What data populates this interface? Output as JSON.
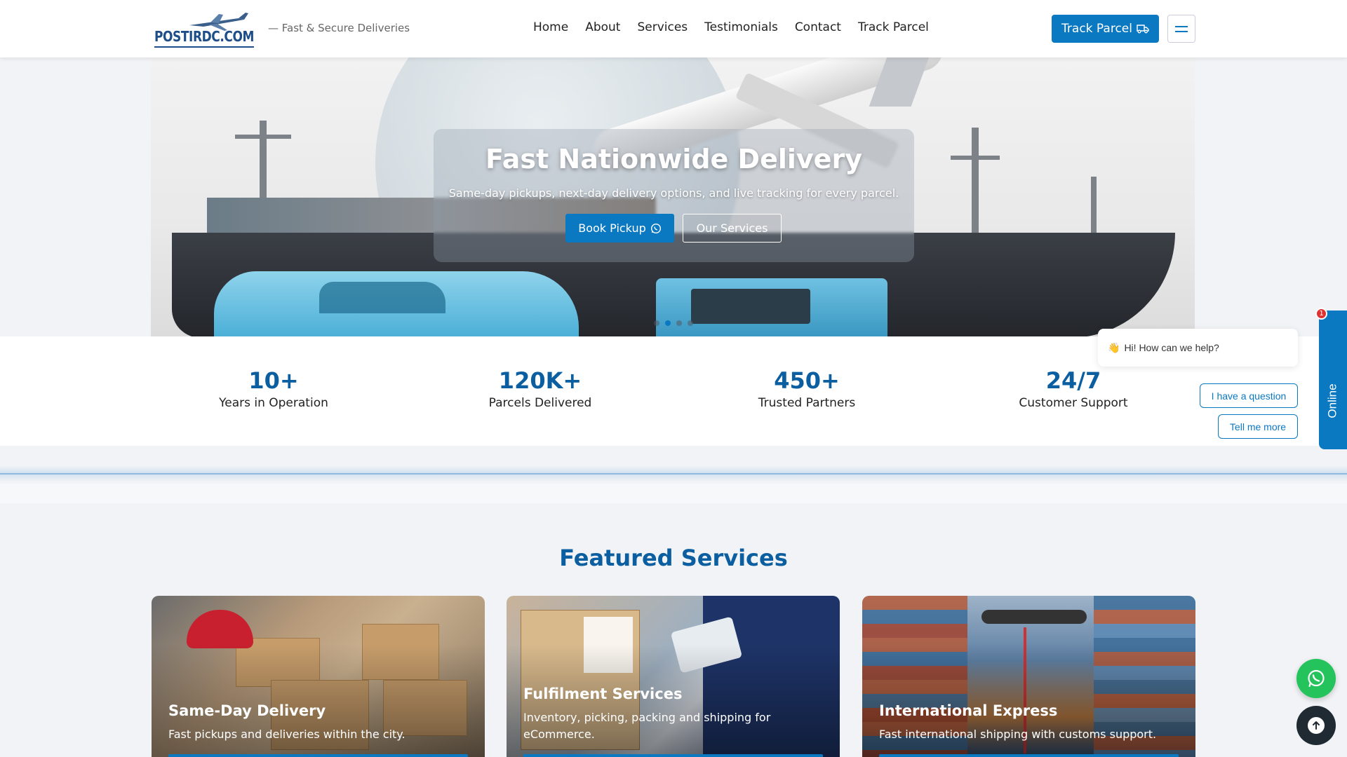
{
  "header": {
    "logo_text": "POSTIRDC.COM",
    "tagline": "— Fast & Secure Deliveries",
    "nav": [
      "Home",
      "About",
      "Services",
      "Testimonials",
      "Contact",
      "Track Parcel"
    ],
    "cta_label": "Track Parcel"
  },
  "hero": {
    "title": "Fast Nationwide Delivery",
    "subtitle": "Same-day pickups, next-day delivery options, and live tracking for every parcel.",
    "primary_button": "Book Pickup",
    "secondary_button": "Our Services",
    "slides": 4,
    "active_slide": 1
  },
  "stats": [
    {
      "value": "10+",
      "label": "Years in Operation"
    },
    {
      "value": "120K+",
      "label": "Parcels Delivered"
    },
    {
      "value": "450+",
      "label": "Trusted Partners"
    },
    {
      "value": "24/7",
      "label": "Customer Support"
    }
  ],
  "featured": {
    "title": "Featured Services",
    "cards": [
      {
        "title": "Same-Day Delivery",
        "desc": "Fast pickups and deliveries within the city."
      },
      {
        "title": "Fulfilment Services",
        "desc": "Inventory, picking, packing and shipping for eCommerce."
      },
      {
        "title": "International Express",
        "desc": "Fast international shipping with customs support."
      }
    ]
  },
  "chat": {
    "greeting": "Hi! How can we help?",
    "emoji": "👋",
    "option1": "I have a question",
    "option2": "Tell me more",
    "status": "Online",
    "badge": "1"
  },
  "colors": {
    "primary": "#0b78c2",
    "heading": "#0b5fa0",
    "whatsapp": "#25c35b"
  }
}
